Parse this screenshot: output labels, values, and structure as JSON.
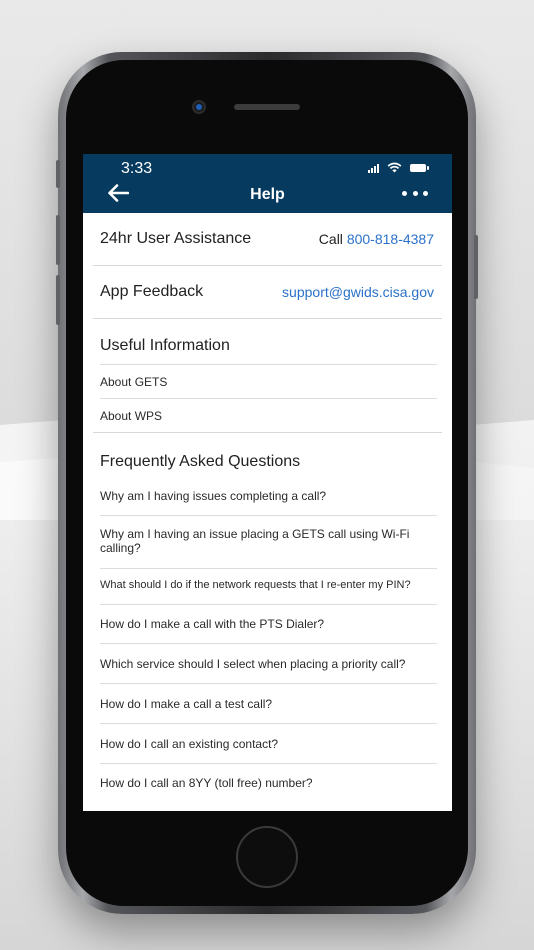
{
  "status_bar": {
    "time": "3:33"
  },
  "header": {
    "title": "Help"
  },
  "assistance": {
    "label": "24hr User Assistance",
    "call_prefix": "Call",
    "phone": "800-818-4387"
  },
  "feedback": {
    "label": "App Feedback",
    "email": "support@gwids.cisa.gov"
  },
  "useful_info": {
    "title": "Useful Information",
    "items": [
      "About GETS",
      "About WPS"
    ]
  },
  "faq": {
    "title": "Frequently Asked Questions",
    "items": [
      "Why am I having issues completing a call?",
      "Why am I having an issue placing a GETS call using Wi-Fi calling?",
      "What should I do if the network requests that I re-enter my PIN?",
      "How do I make a call with the PTS Dialer?",
      "Which service should I select when placing a priority call?",
      "How do I make a call a test call?",
      "How do I call an existing contact?",
      "How do I call an 8YY (toll free) number?"
    ]
  },
  "colors": {
    "header_bg": "#063a5e",
    "link": "#2a72c8"
  },
  "icons": {
    "back": "arrow-left-icon",
    "more": "more-horizontal-icon",
    "signal": "cellular-signal-icon",
    "wifi": "wifi-icon",
    "battery": "battery-icon"
  }
}
